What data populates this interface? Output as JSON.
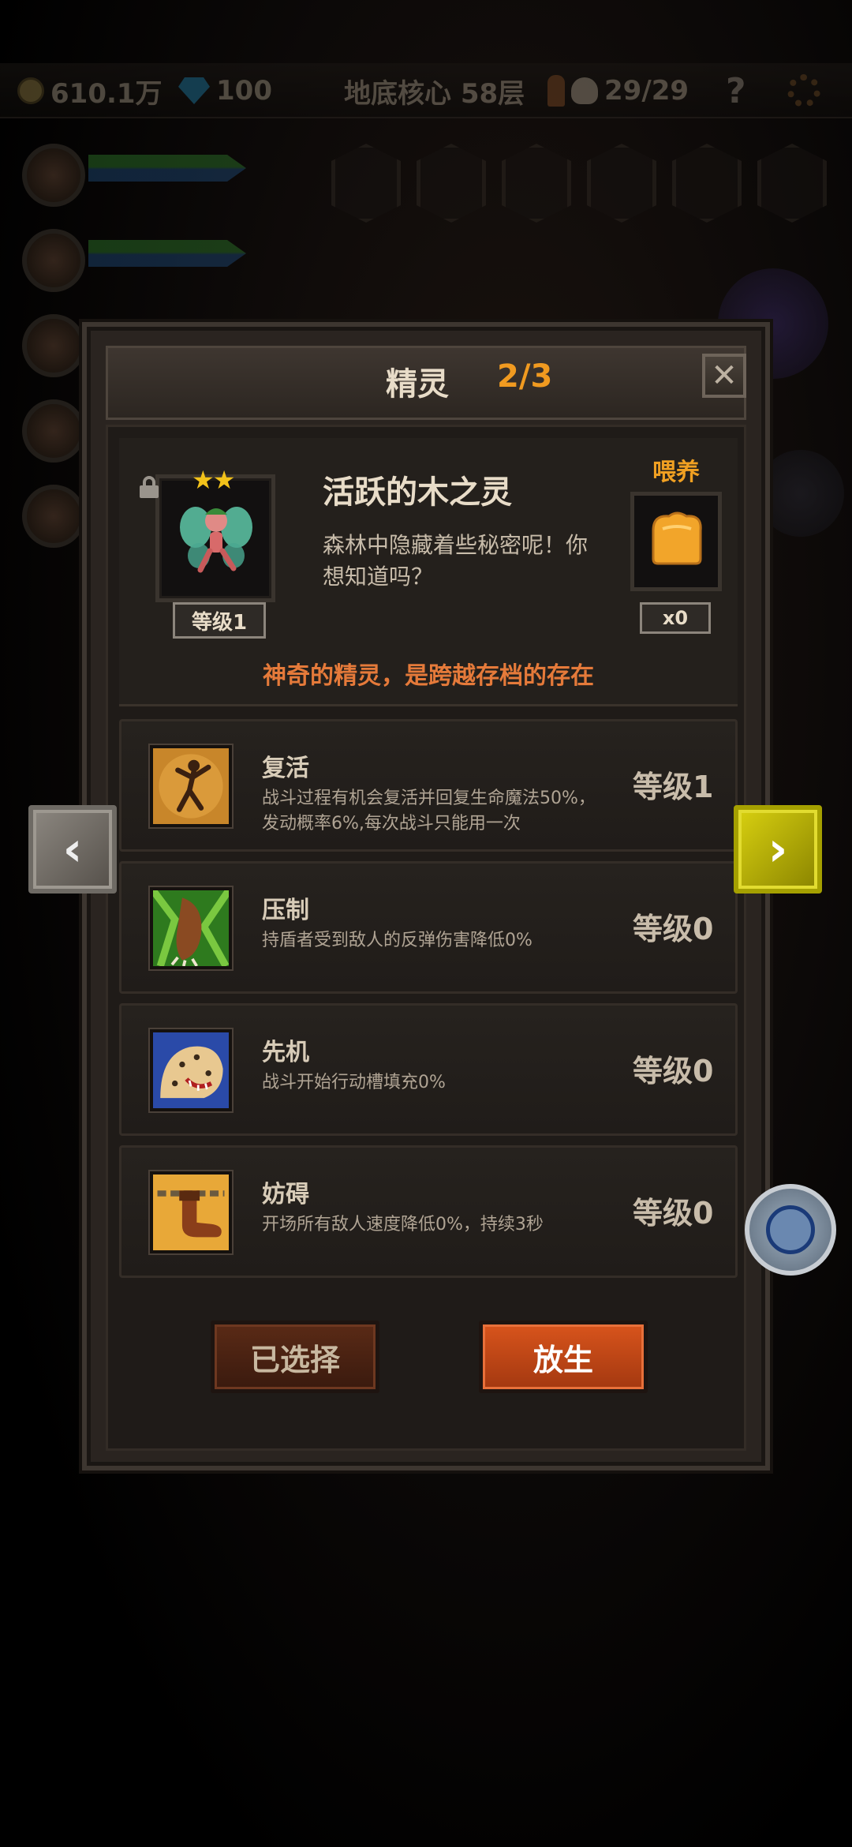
{
  "topbar": {
    "gold": "610.1万",
    "gems": "100",
    "location": "地底核心 58层",
    "kills": "29/29",
    "help_label": "?"
  },
  "dialog": {
    "title": "精灵",
    "page_count": "2/3",
    "close_label": "✕",
    "fairy": {
      "name": "活跃的木之灵",
      "description": "森林中隐藏着些秘密呢！你想知道吗？",
      "level_label": "等级1",
      "stars": "★★",
      "feed_label": "喂养",
      "feed_count": "x0",
      "slogan": "神奇的精灵，是跨越存档的存在"
    },
    "skills": [
      {
        "name": "复活",
        "description": "战斗过程有机会复活并回复生命魔法50%，发动概率6%,每次战斗只能用一次",
        "level": "等级1",
        "icon": "dancer-icon"
      },
      {
        "name": "压制",
        "description": "持盾者受到敌人的反弹伤害降低0%",
        "level": "等级0",
        "icon": "beast-claw-icon"
      },
      {
        "name": "先机",
        "description": "战斗开始行动槽填充0%",
        "level": "等级0",
        "icon": "leopard-icon"
      },
      {
        "name": "妨碍",
        "description": "开场所有敌人速度降低0%，持续3秒",
        "level": "等级0",
        "icon": "chained-boot-icon"
      }
    ],
    "buttons": {
      "selected": "已选择",
      "release": "放生"
    }
  },
  "nav": {
    "prev": "‹",
    "next": "›"
  },
  "colors": {
    "accent_orange": "#f09a20",
    "release_button": "#d8541c",
    "next_arrow": "#d8d010"
  }
}
